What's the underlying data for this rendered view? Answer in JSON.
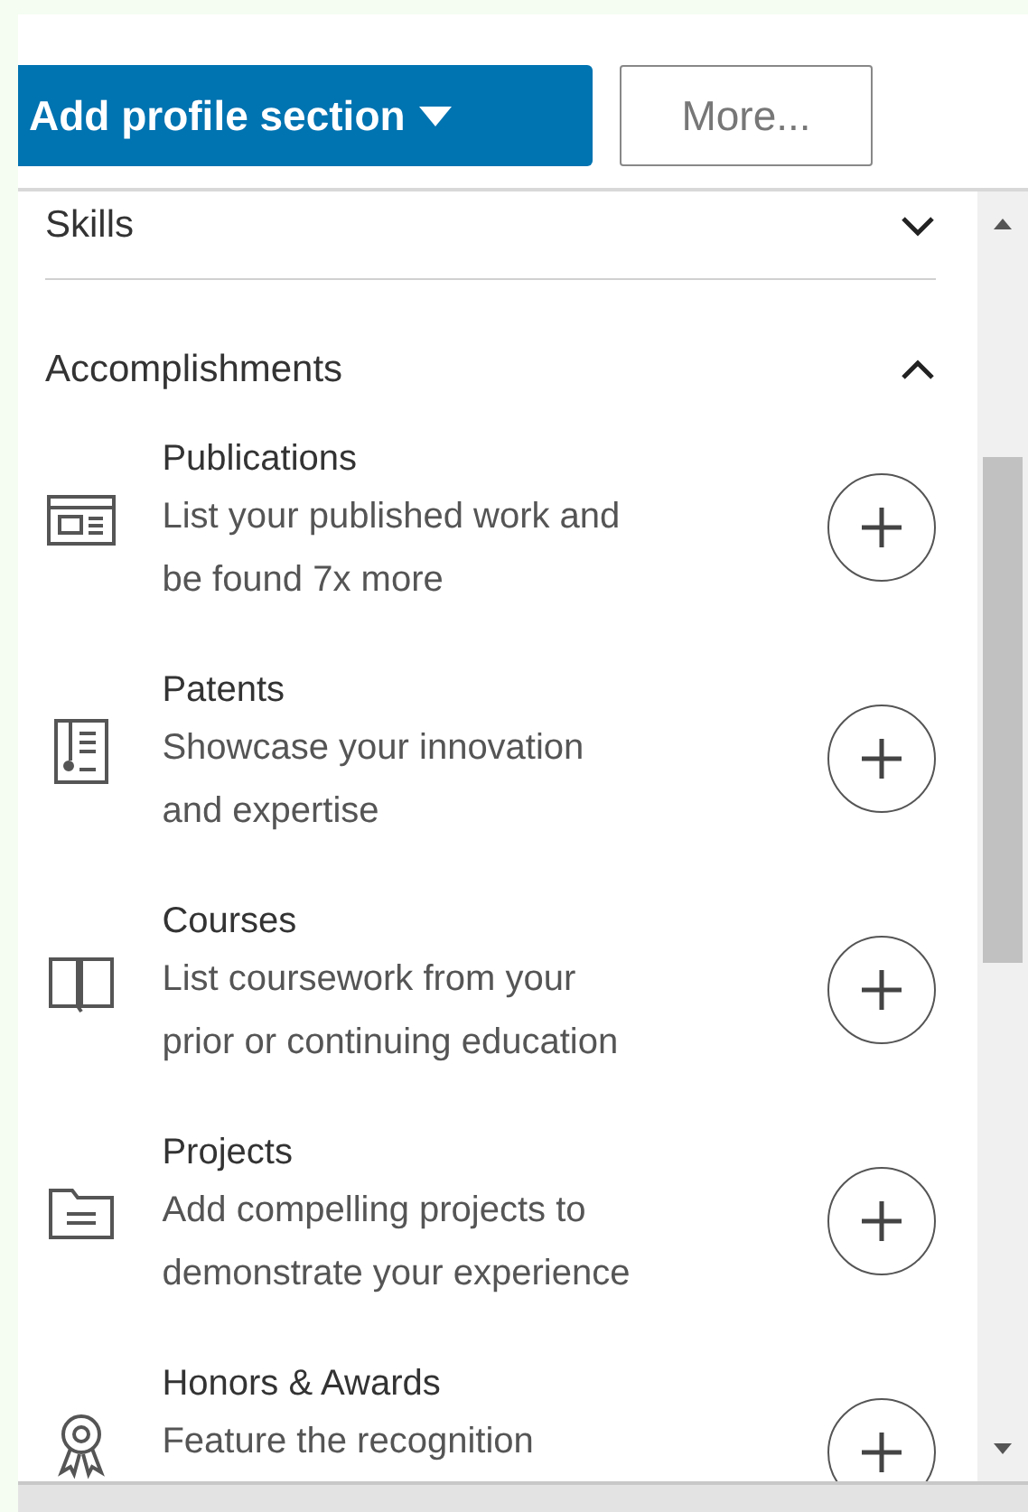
{
  "toolbar": {
    "add_button": "Add profile section",
    "more_button": "More..."
  },
  "sections": [
    {
      "title": "Skills",
      "expanded": false
    },
    {
      "title": "Accomplishments",
      "expanded": true,
      "items": [
        {
          "kind": "publication",
          "title": "Publications",
          "description": "List your published work and\nbe found 7x more"
        },
        {
          "kind": "patent",
          "title": "Patents",
          "description": "Showcase your innovation\nand expertise"
        },
        {
          "kind": "course",
          "title": "Courses",
          "description": "List coursework from your\nprior or continuing education"
        },
        {
          "kind": "project",
          "title": "Projects",
          "description": "Add compelling projects to\ndemonstrate your experience"
        },
        {
          "kind": "award",
          "title": "Honors & Awards",
          "description": "Feature the recognition"
        }
      ]
    }
  ]
}
